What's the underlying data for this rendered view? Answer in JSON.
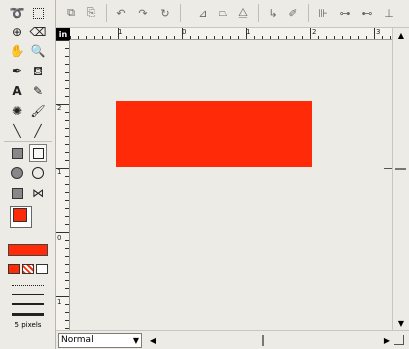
{
  "canvas": {
    "rect_color": "#ff2a07",
    "background": "#ecebe6"
  },
  "rulers": {
    "corner_label": "in",
    "h_labels": [
      "1",
      "0",
      "1",
      "2",
      "3"
    ],
    "v_labels": [
      "2",
      "1",
      "0",
      "1"
    ]
  },
  "tools": [
    "lasso-icon",
    "marquee-icon",
    "crosshair-icon",
    "eraser-icon",
    "hand-icon",
    "zoom-icon",
    "eyedropper-icon",
    "fill-bucket-icon",
    "text-icon",
    "pencil-icon",
    "spray-icon",
    "brush-icon",
    "line-icon",
    "slash-line-icon",
    "filled-rect-icon",
    "rect-icon",
    "filled-ellipse-icon",
    "ellipse-icon",
    "filled-polygon-icon",
    "polygon-icon"
  ],
  "colors": {
    "foreground": "#ff2a07",
    "background": "#ffffff",
    "fill_swatch": "#ff2a07"
  },
  "stroke": {
    "width_label": "5 pixels"
  },
  "bottom": {
    "blend_mode": "Normal"
  }
}
